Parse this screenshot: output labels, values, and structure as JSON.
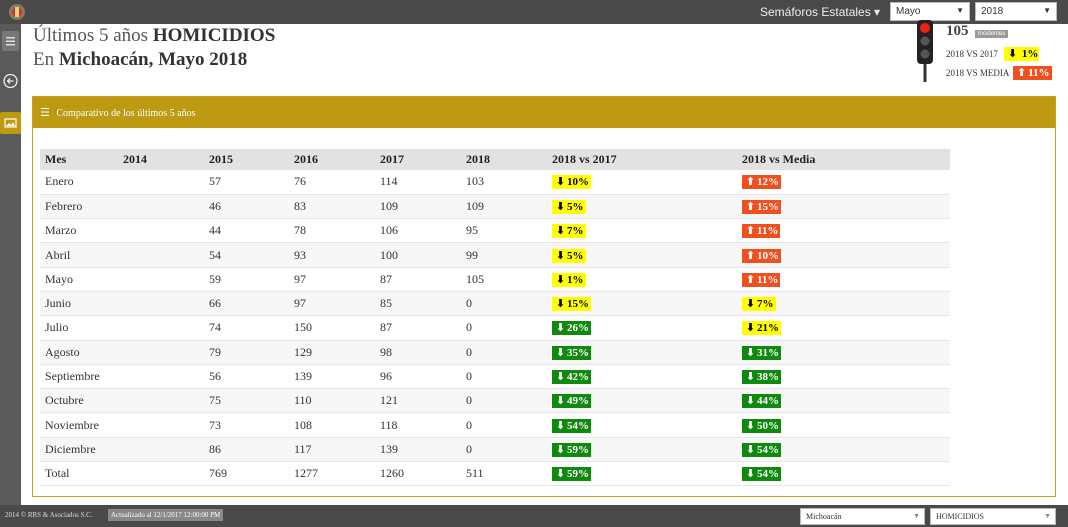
{
  "topbar": {
    "states_menu": "Semáforos Estatales ▾",
    "month_select": "Mayo",
    "year_select": "2018"
  },
  "header": {
    "title_prefix": "Últimos 5 años",
    "title_crime": "HOMICIDIOS",
    "subtitle_prefix": "En",
    "subtitle_place": "Michoacán, Mayo 2018"
  },
  "kpi": {
    "count": "105",
    "count_label": "Incidentes",
    "vs2017_label": "2018 VS 2017",
    "vs2017_value": "1%",
    "vs2017_dir": "down",
    "vs2017_color": "yellow",
    "vsmedia_label": "2018 VS MEDIA",
    "vsmedia_value": "11%",
    "vsmedia_dir": "up",
    "vsmedia_color": "red"
  },
  "panel": {
    "title": "Comparativo de los últimos 5 años"
  },
  "table": {
    "headers": [
      "Mes",
      "2014",
      "2015",
      "2016",
      "2017",
      "2018",
      "2018 vs 2017",
      "2018 vs Media"
    ],
    "rows": [
      {
        "mes": "Enero",
        "y2014": "",
        "y2015": "57",
        "y2016": "76",
        "y2017": "114",
        "y2018": "103",
        "vs17": "10%",
        "vs17_dir": "down",
        "vs17_color": "yellow",
        "vsm": "12%",
        "vsm_dir": "up",
        "vsm_color": "red"
      },
      {
        "mes": "Febrero",
        "y2014": "",
        "y2015": "46",
        "y2016": "83",
        "y2017": "109",
        "y2018": "109",
        "vs17": "5%",
        "vs17_dir": "down",
        "vs17_color": "yellow",
        "vsm": "15%",
        "vsm_dir": "up",
        "vsm_color": "red"
      },
      {
        "mes": "Marzo",
        "y2014": "",
        "y2015": "44",
        "y2016": "78",
        "y2017": "106",
        "y2018": "95",
        "vs17": "7%",
        "vs17_dir": "down",
        "vs17_color": "yellow",
        "vsm": "11%",
        "vsm_dir": "up",
        "vsm_color": "red"
      },
      {
        "mes": "Abril",
        "y2014": "",
        "y2015": "54",
        "y2016": "93",
        "y2017": "100",
        "y2018": "99",
        "vs17": "5%",
        "vs17_dir": "down",
        "vs17_color": "yellow",
        "vsm": "10%",
        "vsm_dir": "up",
        "vsm_color": "red"
      },
      {
        "mes": "Mayo",
        "y2014": "",
        "y2015": "59",
        "y2016": "97",
        "y2017": "87",
        "y2018": "105",
        "vs17": "1%",
        "vs17_dir": "down",
        "vs17_color": "yellow",
        "vsm": "11%",
        "vsm_dir": "up",
        "vsm_color": "red"
      },
      {
        "mes": "Junio",
        "y2014": "",
        "y2015": "66",
        "y2016": "97",
        "y2017": "85",
        "y2018": "0",
        "vs17": "15%",
        "vs17_dir": "down",
        "vs17_color": "yellow",
        "vsm": "7%",
        "vsm_dir": "down",
        "vsm_color": "yellow"
      },
      {
        "mes": "Julio",
        "y2014": "",
        "y2015": "74",
        "y2016": "150",
        "y2017": "87",
        "y2018": "0",
        "vs17": "26%",
        "vs17_dir": "down",
        "vs17_color": "green",
        "vsm": "21%",
        "vsm_dir": "down",
        "vsm_color": "yellow"
      },
      {
        "mes": "Agosto",
        "y2014": "",
        "y2015": "79",
        "y2016": "129",
        "y2017": "98",
        "y2018": "0",
        "vs17": "35%",
        "vs17_dir": "down",
        "vs17_color": "green",
        "vsm": "31%",
        "vsm_dir": "down",
        "vsm_color": "green"
      },
      {
        "mes": "Septiembre",
        "y2014": "",
        "y2015": "56",
        "y2016": "139",
        "y2017": "96",
        "y2018": "0",
        "vs17": "42%",
        "vs17_dir": "down",
        "vs17_color": "green",
        "vsm": "38%",
        "vsm_dir": "down",
        "vsm_color": "green"
      },
      {
        "mes": "Octubre",
        "y2014": "",
        "y2015": "75",
        "y2016": "110",
        "y2017": "121",
        "y2018": "0",
        "vs17": "49%",
        "vs17_dir": "down",
        "vs17_color": "green",
        "vsm": "44%",
        "vsm_dir": "down",
        "vsm_color": "green"
      },
      {
        "mes": "Noviembre",
        "y2014": "",
        "y2015": "73",
        "y2016": "108",
        "y2017": "118",
        "y2018": "0",
        "vs17": "54%",
        "vs17_dir": "down",
        "vs17_color": "green",
        "vsm": "50%",
        "vsm_dir": "down",
        "vsm_color": "green"
      },
      {
        "mes": "Diciembre",
        "y2014": "",
        "y2015": "86",
        "y2016": "117",
        "y2017": "139",
        "y2018": "0",
        "vs17": "59%",
        "vs17_dir": "down",
        "vs17_color": "green",
        "vsm": "54%",
        "vsm_dir": "down",
        "vsm_color": "green"
      },
      {
        "mes": "Total",
        "y2014": "",
        "y2015": "769",
        "y2016": "1277",
        "y2017": "1260",
        "y2018": "511",
        "vs17": "59%",
        "vs17_dir": "down",
        "vs17_color": "green",
        "vsm": "54%",
        "vsm_dir": "down",
        "vsm_color": "green"
      }
    ]
  },
  "footer": {
    "copyright": "2014 © RRS & Asociados S.C.",
    "updated": "Actualizado al 12/1/2017 12:00:00 PM",
    "state_select": "Michoacán",
    "crime_select": "HOMICIDIOS"
  },
  "colors": {
    "panel_header": "#bd9a12",
    "yellow": "#ffff00",
    "red": "#f05020",
    "green": "#0f8a0f",
    "topbar": "#4a4a4a"
  }
}
